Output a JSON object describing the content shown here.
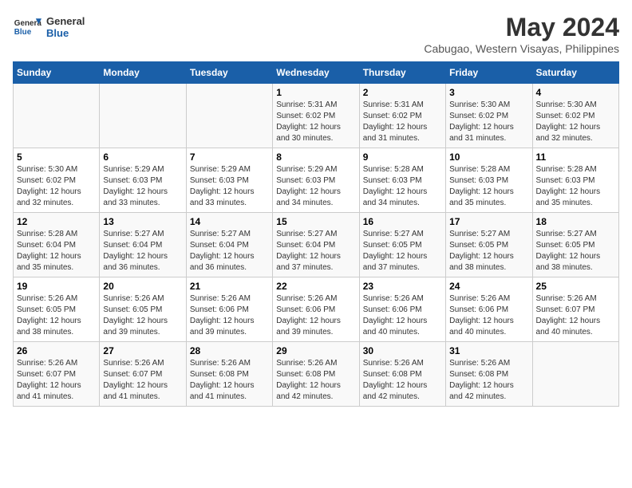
{
  "logo": {
    "text_general": "General",
    "text_blue": "Blue"
  },
  "title": "May 2024",
  "subtitle": "Cabugao, Western Visayas, Philippines",
  "days_of_week": [
    "Sunday",
    "Monday",
    "Tuesday",
    "Wednesday",
    "Thursday",
    "Friday",
    "Saturday"
  ],
  "weeks": [
    [
      {
        "day": "",
        "info": ""
      },
      {
        "day": "",
        "info": ""
      },
      {
        "day": "",
        "info": ""
      },
      {
        "day": "1",
        "info": "Sunrise: 5:31 AM\nSunset: 6:02 PM\nDaylight: 12 hours\nand 30 minutes."
      },
      {
        "day": "2",
        "info": "Sunrise: 5:31 AM\nSunset: 6:02 PM\nDaylight: 12 hours\nand 31 minutes."
      },
      {
        "day": "3",
        "info": "Sunrise: 5:30 AM\nSunset: 6:02 PM\nDaylight: 12 hours\nand 31 minutes."
      },
      {
        "day": "4",
        "info": "Sunrise: 5:30 AM\nSunset: 6:02 PM\nDaylight: 12 hours\nand 32 minutes."
      }
    ],
    [
      {
        "day": "5",
        "info": "Sunrise: 5:30 AM\nSunset: 6:02 PM\nDaylight: 12 hours\nand 32 minutes."
      },
      {
        "day": "6",
        "info": "Sunrise: 5:29 AM\nSunset: 6:03 PM\nDaylight: 12 hours\nand 33 minutes."
      },
      {
        "day": "7",
        "info": "Sunrise: 5:29 AM\nSunset: 6:03 PM\nDaylight: 12 hours\nand 33 minutes."
      },
      {
        "day": "8",
        "info": "Sunrise: 5:29 AM\nSunset: 6:03 PM\nDaylight: 12 hours\nand 34 minutes."
      },
      {
        "day": "9",
        "info": "Sunrise: 5:28 AM\nSunset: 6:03 PM\nDaylight: 12 hours\nand 34 minutes."
      },
      {
        "day": "10",
        "info": "Sunrise: 5:28 AM\nSunset: 6:03 PM\nDaylight: 12 hours\nand 35 minutes."
      },
      {
        "day": "11",
        "info": "Sunrise: 5:28 AM\nSunset: 6:03 PM\nDaylight: 12 hours\nand 35 minutes."
      }
    ],
    [
      {
        "day": "12",
        "info": "Sunrise: 5:28 AM\nSunset: 6:04 PM\nDaylight: 12 hours\nand 35 minutes."
      },
      {
        "day": "13",
        "info": "Sunrise: 5:27 AM\nSunset: 6:04 PM\nDaylight: 12 hours\nand 36 minutes."
      },
      {
        "day": "14",
        "info": "Sunrise: 5:27 AM\nSunset: 6:04 PM\nDaylight: 12 hours\nand 36 minutes."
      },
      {
        "day": "15",
        "info": "Sunrise: 5:27 AM\nSunset: 6:04 PM\nDaylight: 12 hours\nand 37 minutes."
      },
      {
        "day": "16",
        "info": "Sunrise: 5:27 AM\nSunset: 6:05 PM\nDaylight: 12 hours\nand 37 minutes."
      },
      {
        "day": "17",
        "info": "Sunrise: 5:27 AM\nSunset: 6:05 PM\nDaylight: 12 hours\nand 38 minutes."
      },
      {
        "day": "18",
        "info": "Sunrise: 5:27 AM\nSunset: 6:05 PM\nDaylight: 12 hours\nand 38 minutes."
      }
    ],
    [
      {
        "day": "19",
        "info": "Sunrise: 5:26 AM\nSunset: 6:05 PM\nDaylight: 12 hours\nand 38 minutes."
      },
      {
        "day": "20",
        "info": "Sunrise: 5:26 AM\nSunset: 6:05 PM\nDaylight: 12 hours\nand 39 minutes."
      },
      {
        "day": "21",
        "info": "Sunrise: 5:26 AM\nSunset: 6:06 PM\nDaylight: 12 hours\nand 39 minutes."
      },
      {
        "day": "22",
        "info": "Sunrise: 5:26 AM\nSunset: 6:06 PM\nDaylight: 12 hours\nand 39 minutes."
      },
      {
        "day": "23",
        "info": "Sunrise: 5:26 AM\nSunset: 6:06 PM\nDaylight: 12 hours\nand 40 minutes."
      },
      {
        "day": "24",
        "info": "Sunrise: 5:26 AM\nSunset: 6:06 PM\nDaylight: 12 hours\nand 40 minutes."
      },
      {
        "day": "25",
        "info": "Sunrise: 5:26 AM\nSunset: 6:07 PM\nDaylight: 12 hours\nand 40 minutes."
      }
    ],
    [
      {
        "day": "26",
        "info": "Sunrise: 5:26 AM\nSunset: 6:07 PM\nDaylight: 12 hours\nand 41 minutes."
      },
      {
        "day": "27",
        "info": "Sunrise: 5:26 AM\nSunset: 6:07 PM\nDaylight: 12 hours\nand 41 minutes."
      },
      {
        "day": "28",
        "info": "Sunrise: 5:26 AM\nSunset: 6:08 PM\nDaylight: 12 hours\nand 41 minutes."
      },
      {
        "day": "29",
        "info": "Sunrise: 5:26 AM\nSunset: 6:08 PM\nDaylight: 12 hours\nand 42 minutes."
      },
      {
        "day": "30",
        "info": "Sunrise: 5:26 AM\nSunset: 6:08 PM\nDaylight: 12 hours\nand 42 minutes."
      },
      {
        "day": "31",
        "info": "Sunrise: 5:26 AM\nSunset: 6:08 PM\nDaylight: 12 hours\nand 42 minutes."
      },
      {
        "day": "",
        "info": ""
      }
    ]
  ]
}
